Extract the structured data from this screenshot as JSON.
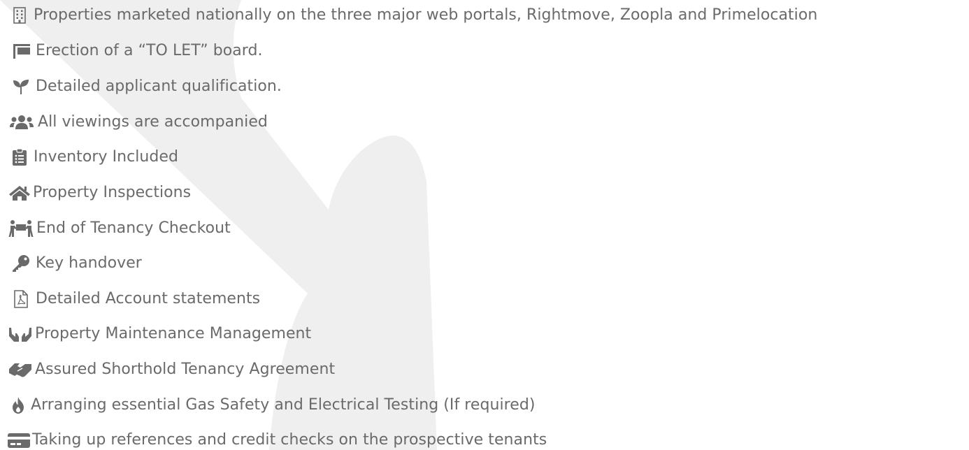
{
  "features": [
    {
      "icon": "building-icon",
      "text": "Properties marketed nationally on the three major web portals, Rightmove, Zoopla and Primelocation"
    },
    {
      "icon": "flag-icon",
      "text": "Erection of a “TO LET” board."
    },
    {
      "icon": "seedling-icon",
      "text": "Detailed applicant qualification."
    },
    {
      "icon": "users-icon",
      "text": "All viewings are accompanied"
    },
    {
      "icon": "clipboard-list-icon",
      "text": "Inventory Included"
    },
    {
      "icon": "home-icon",
      "text": "Property Inspections"
    },
    {
      "icon": "people-carry-icon",
      "text": "End of Tenancy Checkout"
    },
    {
      "icon": "key-icon",
      "text": "Key handover"
    },
    {
      "icon": "file-pdf-icon",
      "text": "Detailed Account statements"
    },
    {
      "icon": "hands-icon",
      "text": "Property Maintenance Management"
    },
    {
      "icon": "handshake-icon",
      "text": "Assured Shorthold Tenancy Agreement"
    },
    {
      "icon": "fire-icon",
      "text": "Arranging essential Gas Safety and Electrical Testing (If required)"
    },
    {
      "icon": "credit-card-icon",
      "text": "Taking up references and credit checks on the prospective tenants"
    }
  ],
  "colors": {
    "text": "#6a6a6a",
    "icon": "#6a6a6a",
    "watermark": "#efefef",
    "background": "#ffffff"
  }
}
